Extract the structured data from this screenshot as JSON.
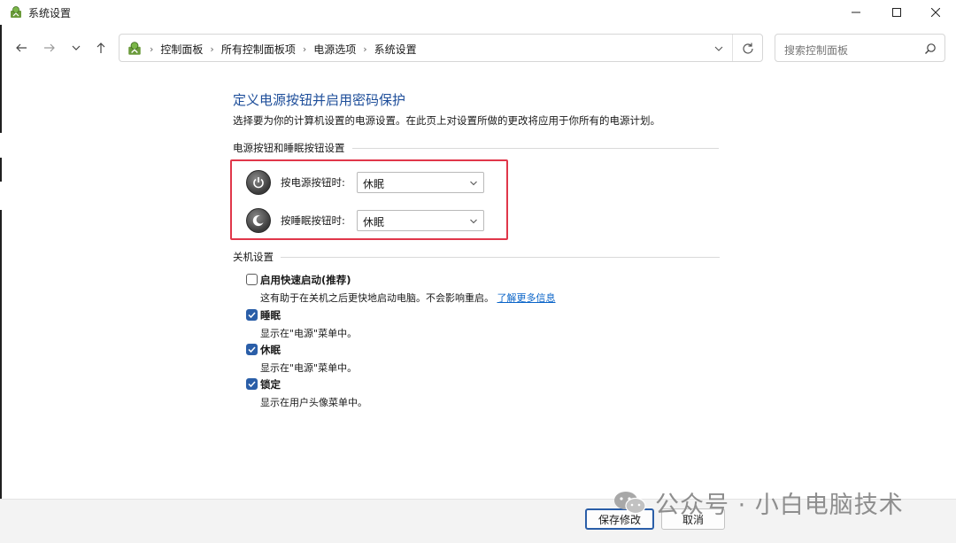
{
  "window": {
    "title": "系统设置",
    "icon": "control-panel-icon"
  },
  "nav": {
    "breadcrumbs": [
      "控制面板",
      "所有控制面板项",
      "电源选项",
      "系统设置"
    ],
    "search_placeholder": "搜索控制面板"
  },
  "page": {
    "heading": "定义电源按钮并启用密码保护",
    "description": "选择要为你的计算机设置的电源设置。在此页上对设置所做的更改将应用于你所有的电源计划。",
    "buttons_section_title": "电源按钮和睡眠按钮设置",
    "power_button_label": "按电源按钮时:",
    "power_button_value": "休眠",
    "sleep_button_label": "按睡眠按钮时:",
    "sleep_button_value": "休眠",
    "shutdown_section_title": "关机设置",
    "options": [
      {
        "label": "启用快速启动(推荐)",
        "desc": "这有助于在关机之后更快地启动电脑。不会影响重启。",
        "link": "了解更多信息",
        "checked": false
      },
      {
        "label": "睡眠",
        "desc": "显示在\"电源\"菜单中。",
        "checked": true
      },
      {
        "label": "休眠",
        "desc": "显示在\"电源\"菜单中。",
        "checked": true
      },
      {
        "label": "锁定",
        "desc": "显示在用户头像菜单中。",
        "checked": true
      }
    ]
  },
  "footer": {
    "save_label": "保存修改",
    "cancel_label": "取消"
  },
  "watermark": {
    "text": "公众号 · 小白电脑技术"
  },
  "colors": {
    "heading": "#1e4e9a",
    "highlight_border": "#e0374a",
    "checkbox_checked": "#2a5ea8",
    "link": "#0a64c8"
  }
}
